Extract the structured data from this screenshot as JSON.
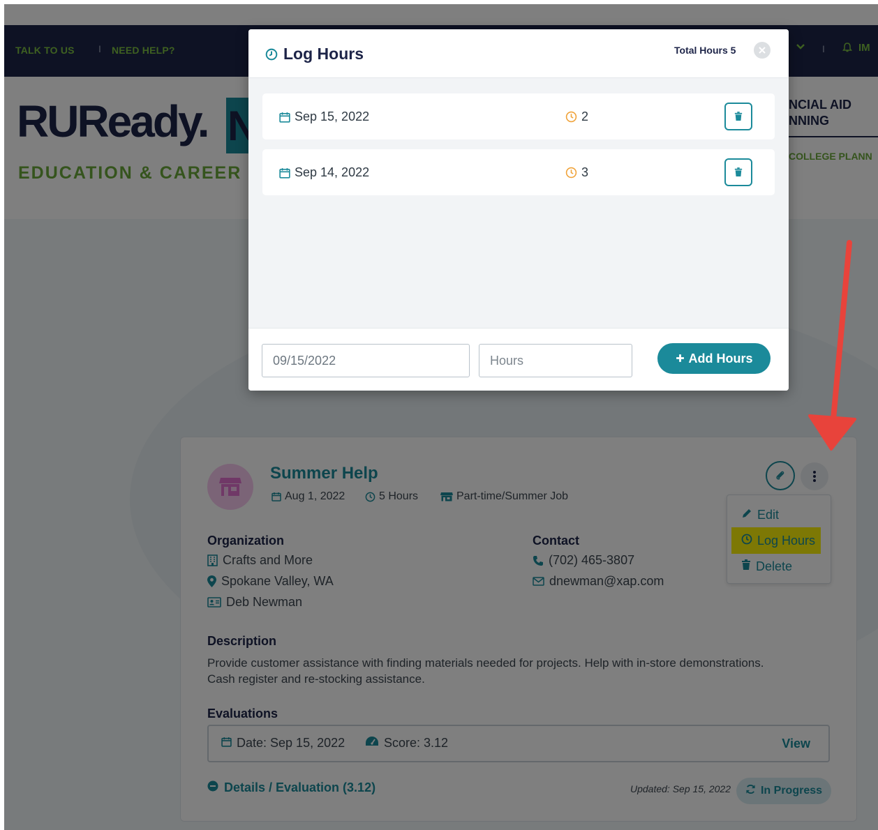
{
  "topbar": {
    "talk_label": "TALK TO US",
    "separator": "I",
    "help_label": "NEED HELP?",
    "right_separator": "I",
    "right_partial": "IM"
  },
  "header": {
    "logo_text": "RUReady.",
    "logo_letter": "N",
    "tagline": "EDUCATION & CAREER",
    "nav_financial_line1": "NCIAL AID",
    "nav_financial_line2": "NNING",
    "nav_college": "COLLEGE PLANN"
  },
  "modal": {
    "title": "Log Hours",
    "total_hours_label": "Total Hours 5",
    "entries": [
      {
        "date": "Sep 15, 2022",
        "hours": "2"
      },
      {
        "date": "Sep 14, 2022",
        "hours": "3"
      }
    ],
    "date_input_value": "09/15/2022",
    "hours_placeholder": "Hours",
    "add_button_label": "Add Hours"
  },
  "card": {
    "title": "Summer Help",
    "date": "Aug 1, 2022",
    "hours": "5 Hours",
    "job_type": "Part-time/Summer Job",
    "organization_heading": "Organization",
    "organization_name": "Crafts and More",
    "location": "Spokane Valley, WA",
    "contact_person": "Deb Newman",
    "contact_heading": "Contact",
    "phone": "(702) 465-3807",
    "email": "dnewman@xap.com",
    "description_heading": "Description",
    "description": "Provide customer assistance with finding materials needed for projects. Help with in-store demonstrations. Cash register and re-stocking assistance.",
    "evaluations_heading": "Evaluations",
    "eval_date": "Date: Sep 15, 2022",
    "eval_score": "Score: 3.12",
    "eval_view": "View",
    "details_link": "Details / Evaluation (3.12)",
    "updated": "Updated: Sep 15, 2022",
    "status": "In Progress"
  },
  "dropdown": {
    "edit": "Edit",
    "log_hours": "Log Hours",
    "delete": "Delete"
  },
  "colors": {
    "navy": "#1d2448",
    "teal": "#1b8a9a",
    "green": "#7cc142",
    "highlight": "#fbf10a",
    "arrow": "#e8433b",
    "clock_orange": "#f0a33a"
  }
}
